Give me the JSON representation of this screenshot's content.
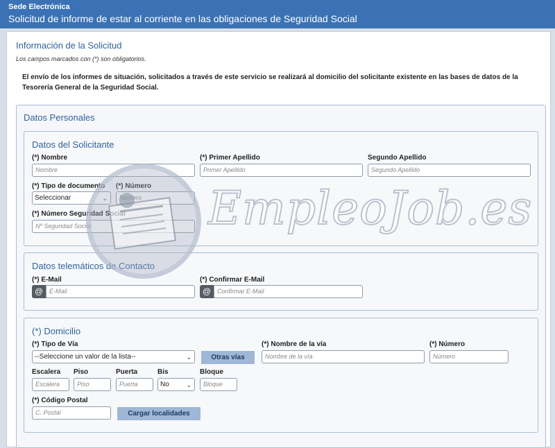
{
  "header": {
    "brand": "Sede Electrónica",
    "title": "Solicitud de informe de estar al corriente en las obligaciones de Seguridad Social"
  },
  "info": {
    "heading": "Información de la Solicitud",
    "required_note": "Los campos marcados con (*) son obligatorios.",
    "notice": "El envío de los informes de situación, solicitados a través de este servicio se realizará al domicilio del solicitante existente en las bases de datos de la Tesorería General de la Seguridad Social."
  },
  "personal": {
    "title": "Datos Personales",
    "solicitante": {
      "title": "Datos del Solicitante",
      "nombre_label": "(*) Nombre",
      "nombre_placeholder": "Nombre",
      "apellido1_label": "(*) Primer Apellido",
      "apellido1_placeholder": "Primer Apellido",
      "apellido2_label": "Segundo Apellido",
      "apellido2_placeholder": "Segundo Apellido",
      "tipo_doc_label": "(*) Tipo de documento",
      "tipo_doc_value": "Seleccionar",
      "numero_label": "(*) Número",
      "numero_placeholder": "Número",
      "nss_label": "(*) Número Seguridad Social",
      "nss_placeholder": "Nº Seguridad Social"
    },
    "contacto": {
      "title": "Datos telemáticos de Contacto",
      "email_label": "(*) E-Mail",
      "email_placeholder": "E-Mail",
      "confirm_label": "(*) Confirmar E-Mail",
      "confirm_placeholder": "Confirmar E-Mail",
      "at_symbol": "@"
    },
    "domicilio": {
      "title": "(*) Domicilio",
      "tipo_via_label": "(*) Tipo de Vía",
      "tipo_via_value": "--Seleccione un valor de la lista--",
      "otras_vias_button": "Otras vías",
      "nombre_via_label": "(*) Nombre de la vía",
      "nombre_via_placeholder": "Nombre de la vía",
      "numero_label": "(*) Número",
      "numero_placeholder": "Número",
      "escalera_label": "Escalera",
      "escalera_placeholder": "Escalera",
      "piso_label": "Piso",
      "piso_placeholder": "Piso",
      "puerta_label": "Puerta",
      "puerta_placeholder": "Puerta",
      "bis_label": "Bis",
      "bis_value": "No",
      "bloque_label": "Bloque",
      "bloque_placeholder": "Bloque",
      "cp_label": "(*) Código Postal",
      "cp_placeholder": "C. Postal",
      "cargar_button": "Cargar localidades"
    }
  },
  "watermark": {
    "text": "EmpleoJob.es"
  },
  "colors": {
    "header_bg": "#3a72b5",
    "heading": "#2f62a0",
    "button_bg": "#9fb7d6"
  }
}
